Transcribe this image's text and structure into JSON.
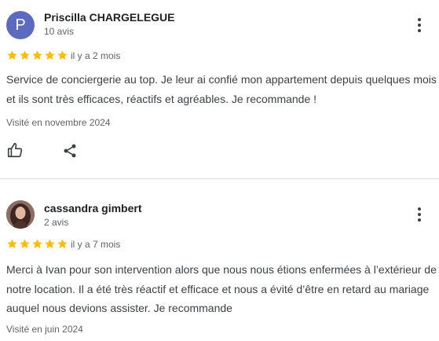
{
  "reviews": [
    {
      "avatar_letter": "P",
      "avatar_color": "#5c6bc0",
      "author": "Priscilla CHARGELEGUE",
      "review_count": "10 avis",
      "rating": 5,
      "date": "il y a 2 mois",
      "text": "Service de conciergerie au top. Je leur ai confié mon appartement depuis quelques mois et ils sont très efficaces, réactifs et agréables. Je recommande !",
      "visited": "Visité en novembre 2024",
      "icons": [
        "thumbs-up-icon",
        "share-icon",
        "more-vert-icon"
      ]
    },
    {
      "avatar_letter": "",
      "author": "cassandra gimbert",
      "review_count": "2 avis",
      "rating": 5,
      "date": "il y a 7 mois",
      "text": "Merci à Ivan pour son intervention alors que nous nous étions enfermées à l’extérieur de notre location. Il a été très réactif et efficace et nous a évité d’être en retard au mariage auquel nous devions assister. Je recommande",
      "visited": "Visité en juin 2024",
      "icons": [
        "more-vert-icon"
      ]
    }
  ],
  "colors": {
    "star": "#fbbc04",
    "text": "#3c4043",
    "muted": "#5f6368",
    "divider": "#dadce0"
  }
}
